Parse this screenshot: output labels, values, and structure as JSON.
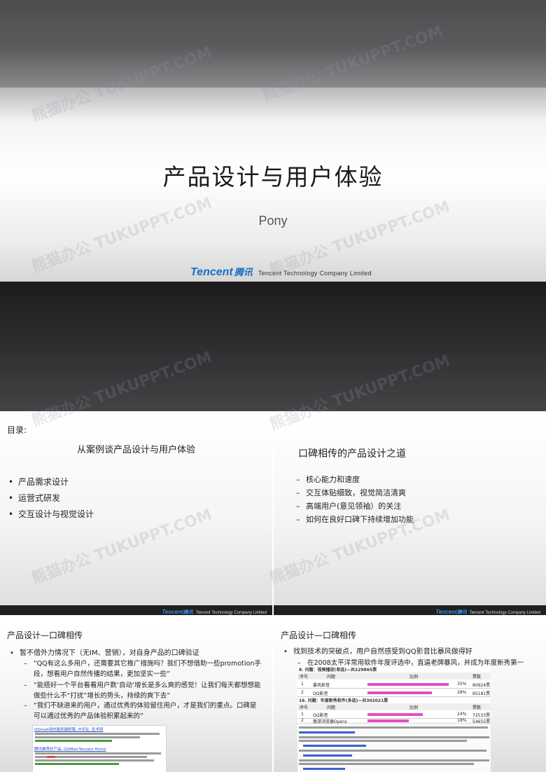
{
  "title_slide": {
    "title": "产品设计与用户体验",
    "author": "Pony",
    "logo_word": "Tencent",
    "logo_cn": "腾讯",
    "company": "Tencent Technology Company Limited"
  },
  "footer": {
    "logo_word": "Tencent",
    "logo_cn": "腾讯",
    "company": "Tencent Technology Company Limited"
  },
  "toc_slide": {
    "label": "目录:",
    "heading": "从案例谈产品设计与用户体验",
    "items": [
      "产品需求设计",
      "运营式研发",
      "交互设计与视觉设计"
    ]
  },
  "wom_slide": {
    "heading": "口碑相传的产品设计之道",
    "items": [
      "核心能力和速度",
      "交互体贴细致，视觉简洁清爽",
      "高端用户(意见领袖）的关注",
      "如何在良好口碑下持续增加功能"
    ]
  },
  "case1_slide": {
    "title": "产品设计—口碑相传",
    "bullet": "暂不借外力情况下（无IM、营销），对自身产品的口碑验证",
    "quotes": [
      "“QQ有这么多用户，还需要其它推广措施吗？我们不想借助一些promotion手段，想看用户自然传播的结果，更加坚实一些”",
      "“能搭好一个平台看看用户数‘自动’增长是多么爽的感觉！让我们每天都想想能做些什么不“打扰”增长的势头，持续的爽下去”",
      "“我们不缺进来的用户，通过优秀的体验留住用户，才是我们的重点。口碑是可以通过优秀的产品体验积累起来的”"
    ],
    "screenshot_links": [
      "QQmail用的越来越舒服, IT评论, 圣术网",
      "腾讯推荐好产品, QQMail-Tencent Home"
    ]
  },
  "case2_slide": {
    "title": "产品设计—口碑相传",
    "bullet": "找到技术的突破点，用户自然感受到QQ影音比暴风做得好",
    "sub": "在2008太平洋常用软件年度评选中，直逼老牌暴风，并成为年度新秀第一",
    "poll1": {
      "title": "8. 问题：视频播放(单选)—共229865票",
      "headers": [
        "序号",
        "问题",
        "比例",
        "票数"
      ],
      "rows": [
        {
          "no": "1",
          "name": "暴风影音",
          "pct": "35%",
          "votes": "80924票",
          "value": 35
        },
        {
          "no": "2",
          "name": "QQ影音",
          "pct": "28%",
          "votes": "65181票",
          "value": 28
        }
      ]
    },
    "poll2": {
      "title": "16. 问题：年度新秀软件(多选)—共302021票",
      "headers": [
        "序号",
        "问题",
        "比例",
        "票数"
      ],
      "rows": [
        {
          "no": "1",
          "name": "QQ影音",
          "pct": "24%",
          "votes": "72533票",
          "value": 24
        },
        {
          "no": "2",
          "name": "傲游浏览器Opera",
          "pct": "18%",
          "votes": "54655票",
          "value": 18
        }
      ]
    }
  },
  "watermark": "熊猫办公 TUKUPPT.COM"
}
